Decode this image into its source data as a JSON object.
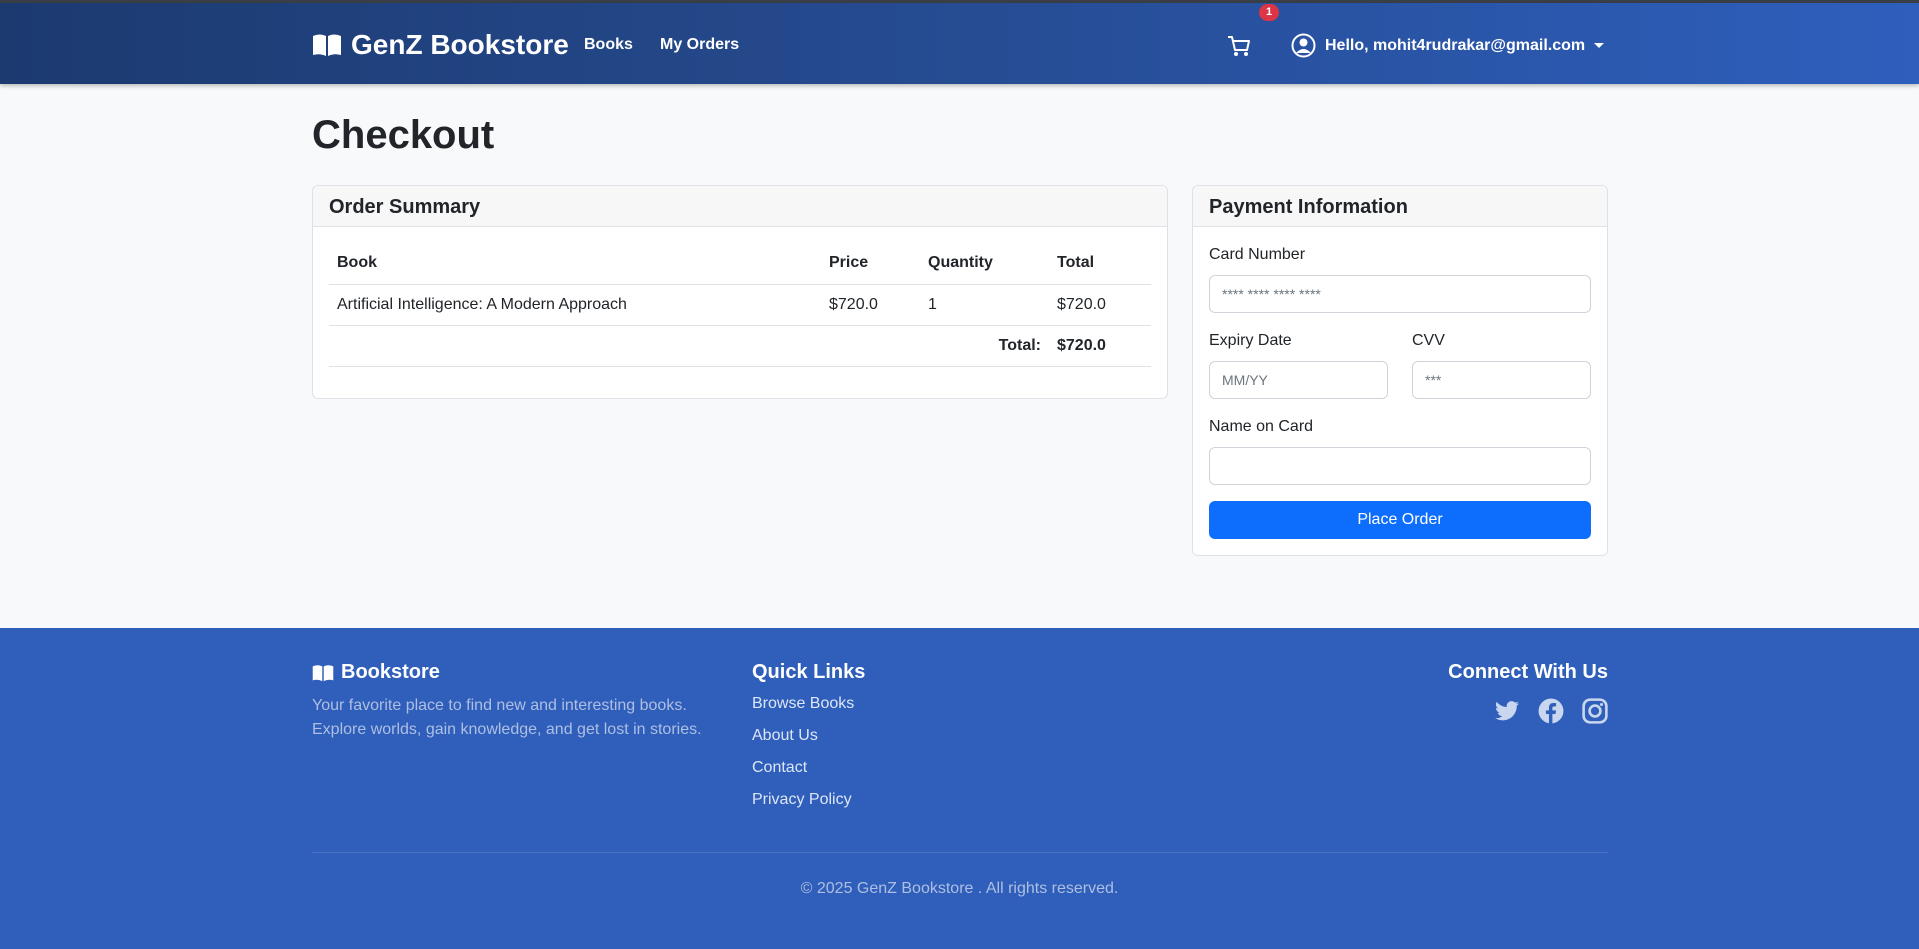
{
  "navbar": {
    "brand": "GenZ Bookstore",
    "links": [
      "Books",
      "My Orders"
    ],
    "cart_count": "1",
    "user_greeting": "Hello, mohit4rudrakar@gmail.com"
  },
  "page": {
    "title": "Checkout"
  },
  "order_summary": {
    "header": "Order Summary",
    "columns": [
      "Book",
      "Price",
      "Quantity",
      "Total"
    ],
    "rows": [
      {
        "book": "Artificial Intelligence: A Modern Approach",
        "price": "$720.0",
        "quantity": "1",
        "total": "$720.0"
      }
    ],
    "total_label": "Total:",
    "total_value": "$720.0"
  },
  "payment": {
    "header": "Payment Information",
    "card_number_label": "Card Number",
    "card_number_placeholder": "**** **** **** ****",
    "expiry_label": "Expiry Date",
    "expiry_placeholder": "MM/YY",
    "cvv_label": "CVV",
    "cvv_placeholder": "***",
    "name_label": "Name on Card",
    "name_value": "",
    "submit_label": "Place Order"
  },
  "footer": {
    "brand": "Bookstore",
    "tagline": "Your favorite place to find new and interesting books. Explore worlds, gain knowledge, and get lost in stories.",
    "quick_links_title": "Quick Links",
    "quick_links": [
      "Browse Books",
      "About Us",
      "Contact",
      "Privacy Policy"
    ],
    "connect_title": "Connect With Us",
    "social_icons": [
      "twitter-icon",
      "facebook-icon",
      "instagram-icon"
    ],
    "copyright": "© 2025 GenZ Bookstore . All rights reserved."
  },
  "colors": {
    "navbar_start": "#1c3a70",
    "navbar_end": "#2e5fbd",
    "primary_button": "#0d6efd",
    "footer_bg": "#2f5fba",
    "badge": "#dc3545"
  }
}
